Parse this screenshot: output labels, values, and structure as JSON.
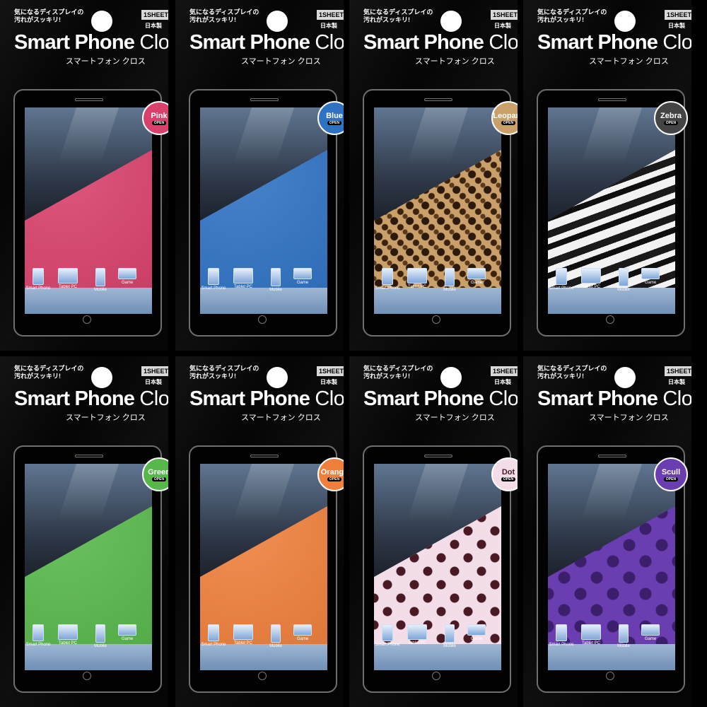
{
  "packs": [
    {
      "tagline": "気になるディスプレイの\n汚れがスッキリ!",
      "sheet": "1SHEET",
      "madein": "日本製",
      "title_bold": "Smart Phone",
      "title_light": "Cloth",
      "subtitle": "スマートフォン クロス",
      "variant": "Pink",
      "open": "OPEN",
      "color": "#d9406b",
      "pattern": "plain",
      "dock": [
        "Smart Phone",
        "Tablet PC",
        "Mobile",
        "Game"
      ]
    },
    {
      "tagline": "気になるディスプレイの\n汚れがスッキリ!",
      "sheet": "1SHEET",
      "madein": "日本製",
      "title_bold": "Smart Phone",
      "title_light": "Cloth",
      "subtitle": "スマートフォン クロス",
      "variant": "Blue",
      "open": "OPEN",
      "color": "#2f72c4",
      "pattern": "plain",
      "dock": [
        "Smart Phone",
        "Tablet PC",
        "Mobile",
        "Game"
      ]
    },
    {
      "tagline": "気になるディスプレイの\n汚れがスッキリ!",
      "sheet": "1SHEET",
      "madein": "日本製",
      "title_bold": "Smart Phone",
      "title_light": "Cloth",
      "subtitle": "スマートフォン クロス",
      "variant": "Leopard",
      "open": "OPEN",
      "color": "#caa06a",
      "pattern": "leopard",
      "dock": [
        "Smart Phone",
        "Tablet PC",
        "Mobile",
        "Game"
      ]
    },
    {
      "tagline": "気になるディスプレイの\n汚れがスッキリ!",
      "sheet": "1SHEET",
      "madein": "日本製",
      "title_bold": "Smart Phone",
      "title_light": "Cloth",
      "subtitle": "スマートフォン クロス",
      "variant": "Zebra",
      "open": "OPEN",
      "color": "#e8e8e8",
      "pattern": "zebra",
      "dock": [
        "Smart Phone",
        "Tablet PC",
        "Mobile",
        "Game"
      ]
    },
    {
      "tagline": "気になるディスプレイの\n汚れがスッキリ!",
      "sheet": "1SHEET",
      "madein": "日本製",
      "title_bold": "Smart Phone",
      "title_light": "Cloth",
      "subtitle": "スマートフォン クロス",
      "variant": "Green",
      "open": "OPEN",
      "color": "#57b84a",
      "pattern": "plain",
      "dock": [
        "Smart Phone",
        "Tablet PC",
        "Mobile",
        "Game"
      ]
    },
    {
      "tagline": "気になるディスプレイの\n汚れがスッキリ!",
      "sheet": "1SHEET",
      "madein": "日本製",
      "title_bold": "Smart Phone",
      "title_light": "Cloth",
      "subtitle": "スマートフォン クロス",
      "variant": "Orange",
      "open": "OPEN",
      "color": "#ef7f3a",
      "pattern": "plain",
      "dock": [
        "Smart Phone",
        "Tablet PC",
        "Mobile",
        "Game"
      ]
    },
    {
      "tagline": "気になるディスプレイの\n汚れがスッキリ!",
      "sheet": "1SHEET",
      "madein": "日本製",
      "title_bold": "Smart Phone",
      "title_light": "Cloth",
      "subtitle": "スマートフォン クロス",
      "variant": "Dot",
      "open": "OPEN",
      "color": "#f2dde8",
      "pattern": "dots",
      "dock": [
        "Smart Phone",
        "Tablet PC",
        "Mobile",
        "Game"
      ]
    },
    {
      "tagline": "気になるディスプレイの\n汚れがスッキリ!",
      "sheet": "1SHEET",
      "madein": "日本製",
      "title_bold": "Smart Phone",
      "title_light": "Cloth",
      "subtitle": "スマートフォン クロス",
      "variant": "Scull",
      "open": "OPEN",
      "color": "#6a3db0",
      "pattern": "skull",
      "dock": [
        "Smart Phone",
        "Tablet PC",
        "Mobile",
        "Game"
      ]
    }
  ]
}
